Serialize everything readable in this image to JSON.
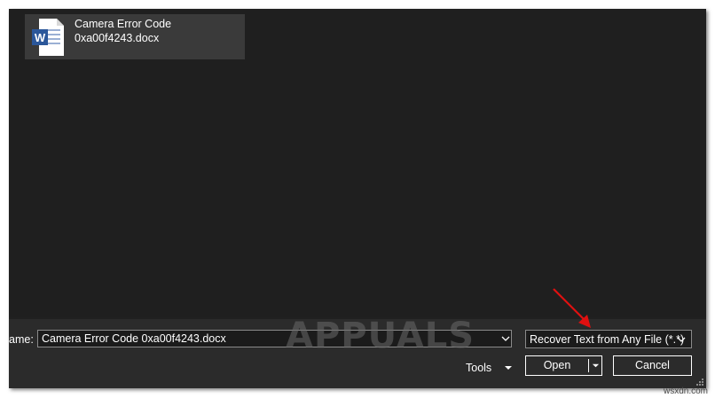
{
  "file_list": {
    "items": [
      {
        "name_line1": "Camera Error Code",
        "name_line2": "0xa00f4243.docx",
        "icon": "word-document-icon"
      }
    ]
  },
  "bottom_bar": {
    "file_name_label": "ame:",
    "file_name_value": "Camera Error Code 0xa00f4243.docx",
    "file_type_selected": "Recover Text from Any File (*.*)",
    "tools_label": "Tools",
    "open_label": "Open",
    "cancel_label": "Cancel"
  },
  "watermark": {
    "text": "APPUALS"
  },
  "footer": {
    "brand": "wsxdn.com"
  },
  "colors": {
    "dialog_bg": "#202020",
    "tile_bg": "#3a3a3a",
    "word_blue": "#2b579a",
    "arrow_red": "#e01010"
  }
}
